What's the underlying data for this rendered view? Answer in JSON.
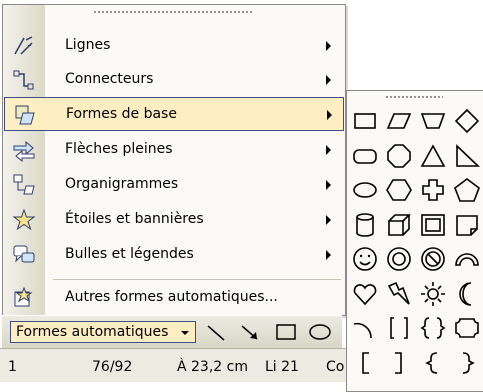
{
  "menu": {
    "items": [
      {
        "label": "Lignes",
        "icon": "lines-icon",
        "submenu": true
      },
      {
        "label": "Connecteurs",
        "icon": "connectors-icon",
        "submenu": true
      },
      {
        "label": "Formes de base",
        "icon": "basic-shapes-icon",
        "submenu": true,
        "highlighted": true
      },
      {
        "label": "Flèches pleines",
        "icon": "block-arrows-icon",
        "submenu": true
      },
      {
        "label": "Organigrammes",
        "icon": "flowchart-icon",
        "submenu": true
      },
      {
        "label": "Étoiles et bannières",
        "icon": "stars-banners-icon",
        "submenu": true
      },
      {
        "label": "Bulles et légendes",
        "icon": "callouts-icon",
        "submenu": true
      },
      {
        "label": "Autres formes automatiques...",
        "icon": "more-autoshapes-icon",
        "submenu": false
      }
    ]
  },
  "toolbar": {
    "autoshapes_label": "Formes automatiques",
    "tools": [
      "line-icon",
      "arrow-icon",
      "rectangle-icon",
      "oval-icon"
    ]
  },
  "statusbar": {
    "page": "1",
    "section": "76/92",
    "position": "À 23,2 cm",
    "line": "Li 21",
    "column": "Co"
  },
  "palette": {
    "shapes": [
      "rectangle-icon",
      "parallelogram-icon",
      "trapezoid-icon",
      "diamond-icon",
      "rounded-rectangle-icon",
      "octagon-icon",
      "triangle-icon",
      "right-triangle-icon",
      "oval-icon",
      "hexagon-icon",
      "cross-icon",
      "pentagon-icon",
      "can-icon",
      "cube-icon",
      "bevel-icon",
      "folded-corner-icon",
      "smiley-face-icon",
      "donut-icon",
      "no-symbol-icon",
      "block-arc-icon",
      "heart-icon",
      "lightning-bolt-icon",
      "sun-icon",
      "moon-icon",
      "arc-icon",
      "double-bracket-icon",
      "double-brace-icon",
      "plaque-icon",
      "left-bracket-icon",
      "right-bracket-icon",
      "left-brace-icon",
      "right-brace-icon"
    ]
  },
  "colors": {
    "highlight_bg": "#ffeec2",
    "highlight_border": "#3b4f86",
    "menu_bg": "#fbfaf6",
    "gutter": "#dcd9c7"
  }
}
